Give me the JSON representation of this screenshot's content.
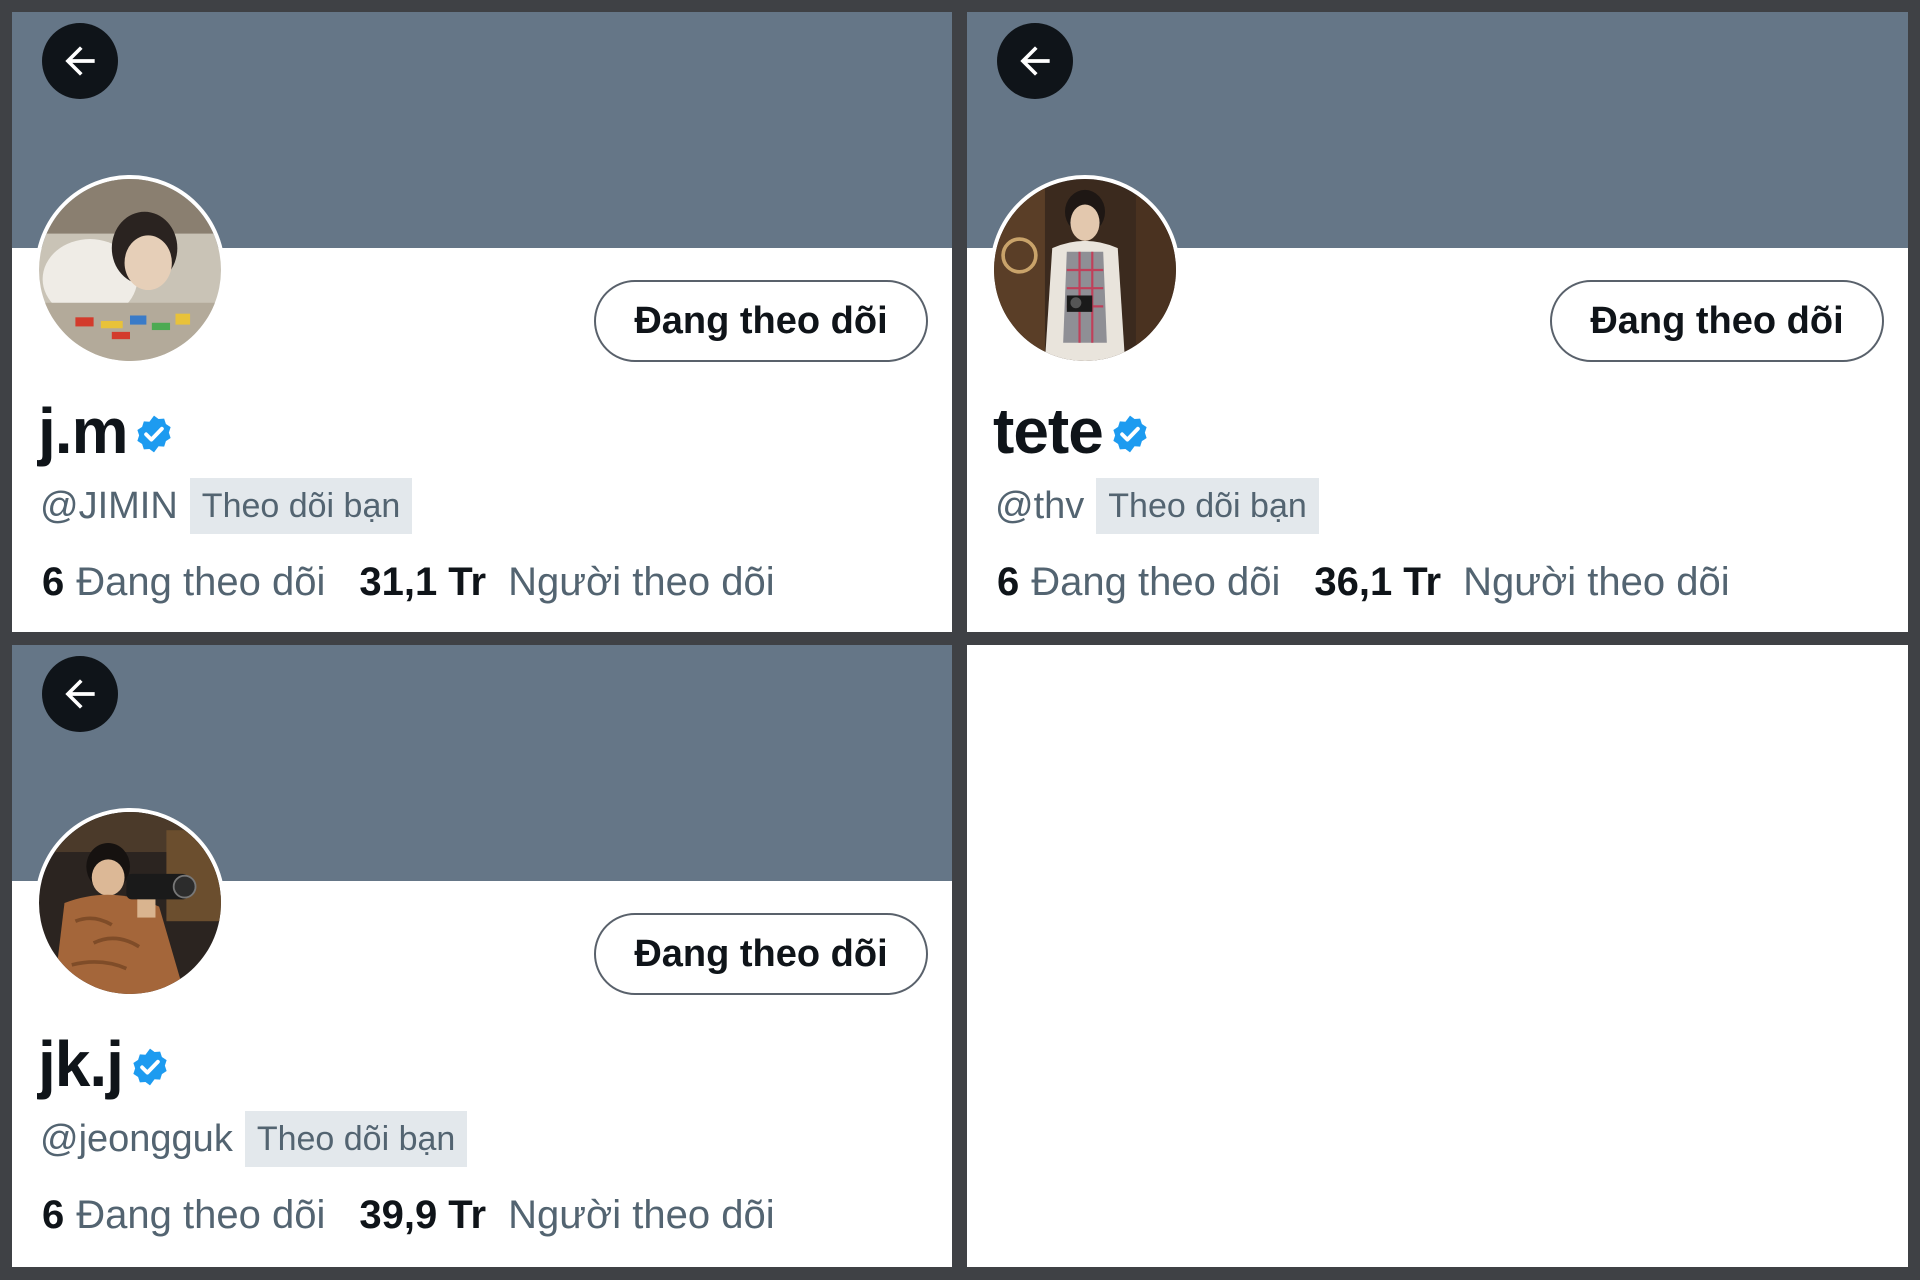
{
  "profiles": [
    {
      "display_name": "j.m",
      "handle": "@JIMIN",
      "follows_you_label": "Theo dõi bạn",
      "follow_button_label": "Đang theo dõi",
      "following_count": "6",
      "following_label": "Đang theo dõi",
      "followers_count": "31,1 Tr",
      "followers_label": "Người theo dõi",
      "verified": true
    },
    {
      "display_name": "tete",
      "handle": "@thv",
      "follows_you_label": "Theo dõi bạn",
      "follow_button_label": "Đang theo dõi",
      "following_count": "6",
      "following_label": "Đang theo dõi",
      "followers_count": "36,1 Tr",
      "followers_label": "Người theo dõi",
      "verified": true
    },
    {
      "display_name": "jk.j",
      "handle": "@jeongguk",
      "follows_you_label": "Theo dõi bạn",
      "follow_button_label": "Đang theo dõi",
      "following_count": "6",
      "following_label": "Đang theo dõi",
      "followers_count": "39,9 Tr",
      "followers_label": "Người theo dõi",
      "verified": true
    }
  ],
  "icons": {
    "back": "arrow-left-icon",
    "verified": "verified-badge-icon"
  },
  "colors": {
    "banner": "#657687",
    "verified": "#1d9bf0",
    "secondary_text": "#536471",
    "follows_you_bg": "#e3e8ec"
  }
}
